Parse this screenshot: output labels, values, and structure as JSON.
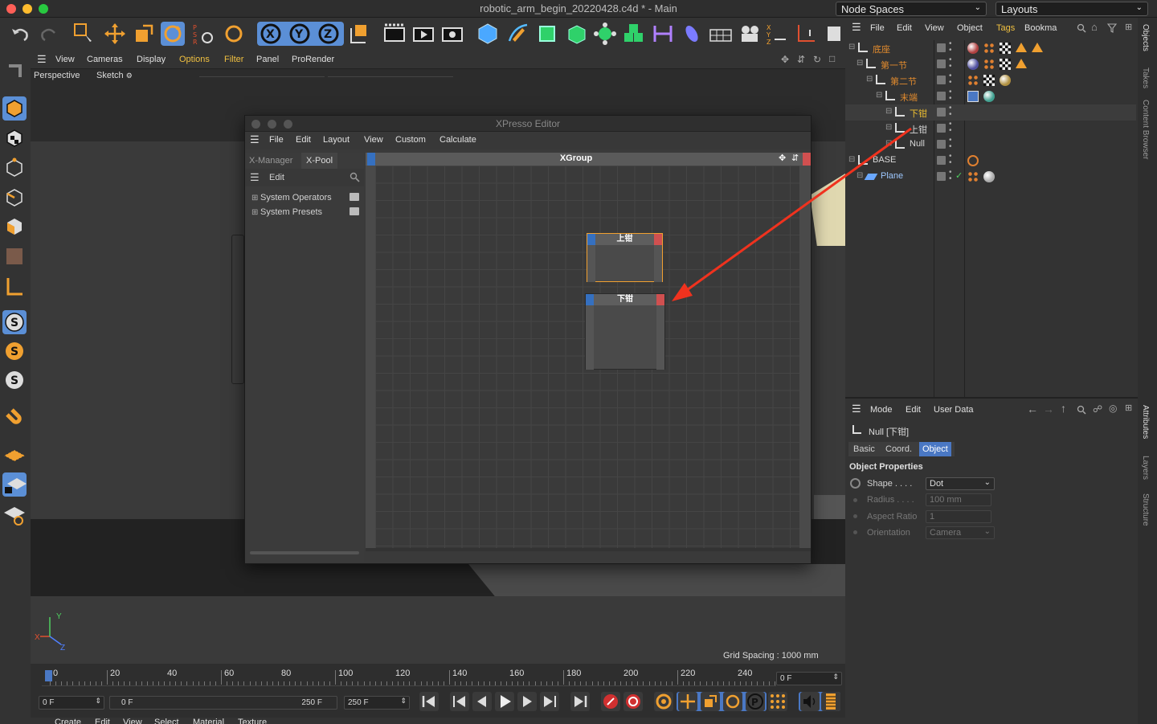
{
  "window": {
    "title": "robotic_arm_begin_20220428.c4d * - Main"
  },
  "top_dropdowns": {
    "node_spaces": "Node Spaces",
    "layouts": "Layouts"
  },
  "viewport": {
    "menu": [
      "View",
      "Cameras",
      "Display",
      "Options",
      "Filter",
      "Panel",
      "ProRender"
    ],
    "camera": "Perspective",
    "mode": "Sketch",
    "grid_spacing": "Grid Spacing : 1000 mm",
    "axis": {
      "x": "X",
      "y": "Y",
      "z": "Z"
    }
  },
  "xpresso": {
    "title": "XPresso Editor",
    "menu": [
      "File",
      "Edit",
      "Layout",
      "View",
      "Custom",
      "Calculate"
    ],
    "tabs": [
      "X-Manager",
      "X-Pool"
    ],
    "left_menu": "Edit",
    "tree": [
      "System Operators",
      "System Presets"
    ],
    "group_title": "XGroup",
    "nodes": [
      {
        "label": "上钳"
      },
      {
        "label": "下钳"
      }
    ]
  },
  "objects": {
    "menu": [
      "File",
      "Edit",
      "View",
      "Object",
      "Tags",
      "Bookma"
    ],
    "items": [
      {
        "name": "底座",
        "color": "#e08a2e"
      },
      {
        "name": "第一节",
        "color": "#e08a2e"
      },
      {
        "name": "第二节",
        "color": "#e08a2e"
      },
      {
        "name": "末端",
        "color": "#e08a2e"
      },
      {
        "name": "下钳",
        "color": "#f0c030"
      },
      {
        "name": "上钳",
        "color": "#d8d8d8"
      },
      {
        "name": "Null",
        "color": "#d8d8d8"
      },
      {
        "name": "BASE",
        "color": "#d8d8d8"
      },
      {
        "name": "Plane",
        "color": "#9ec8ff"
      }
    ]
  },
  "side_tabs": {
    "top": [
      "Objects",
      "Takes",
      "Content Browser"
    ],
    "bottom": [
      "Attributes",
      "Layers",
      "Structure"
    ]
  },
  "attributes": {
    "menu": [
      "Mode",
      "Edit",
      "User Data"
    ],
    "object_name": "Null [下钳]",
    "tabs": [
      "Basic",
      "Coord.",
      "Object"
    ],
    "section": "Object Properties",
    "fields": [
      {
        "label": "Shape . . . .",
        "value": "Dot"
      },
      {
        "label": "Radius . . . .",
        "value": "100 mm"
      },
      {
        "label": "Aspect Ratio",
        "value": "1"
      },
      {
        "label": "Orientation",
        "value": "Camera"
      }
    ]
  },
  "timeline": {
    "ticks": [
      "0",
      "20",
      "40",
      "60",
      "80",
      "100",
      "120",
      "140",
      "160",
      "180",
      "200",
      "220",
      "240"
    ],
    "current_frame": "0 F",
    "start": "0 F",
    "range_start": "0 F",
    "range_end": "250 F",
    "end": "250 F"
  },
  "bottom_menu": [
    "Create",
    "Edit",
    "View",
    "Select",
    "Material",
    "Texture"
  ]
}
